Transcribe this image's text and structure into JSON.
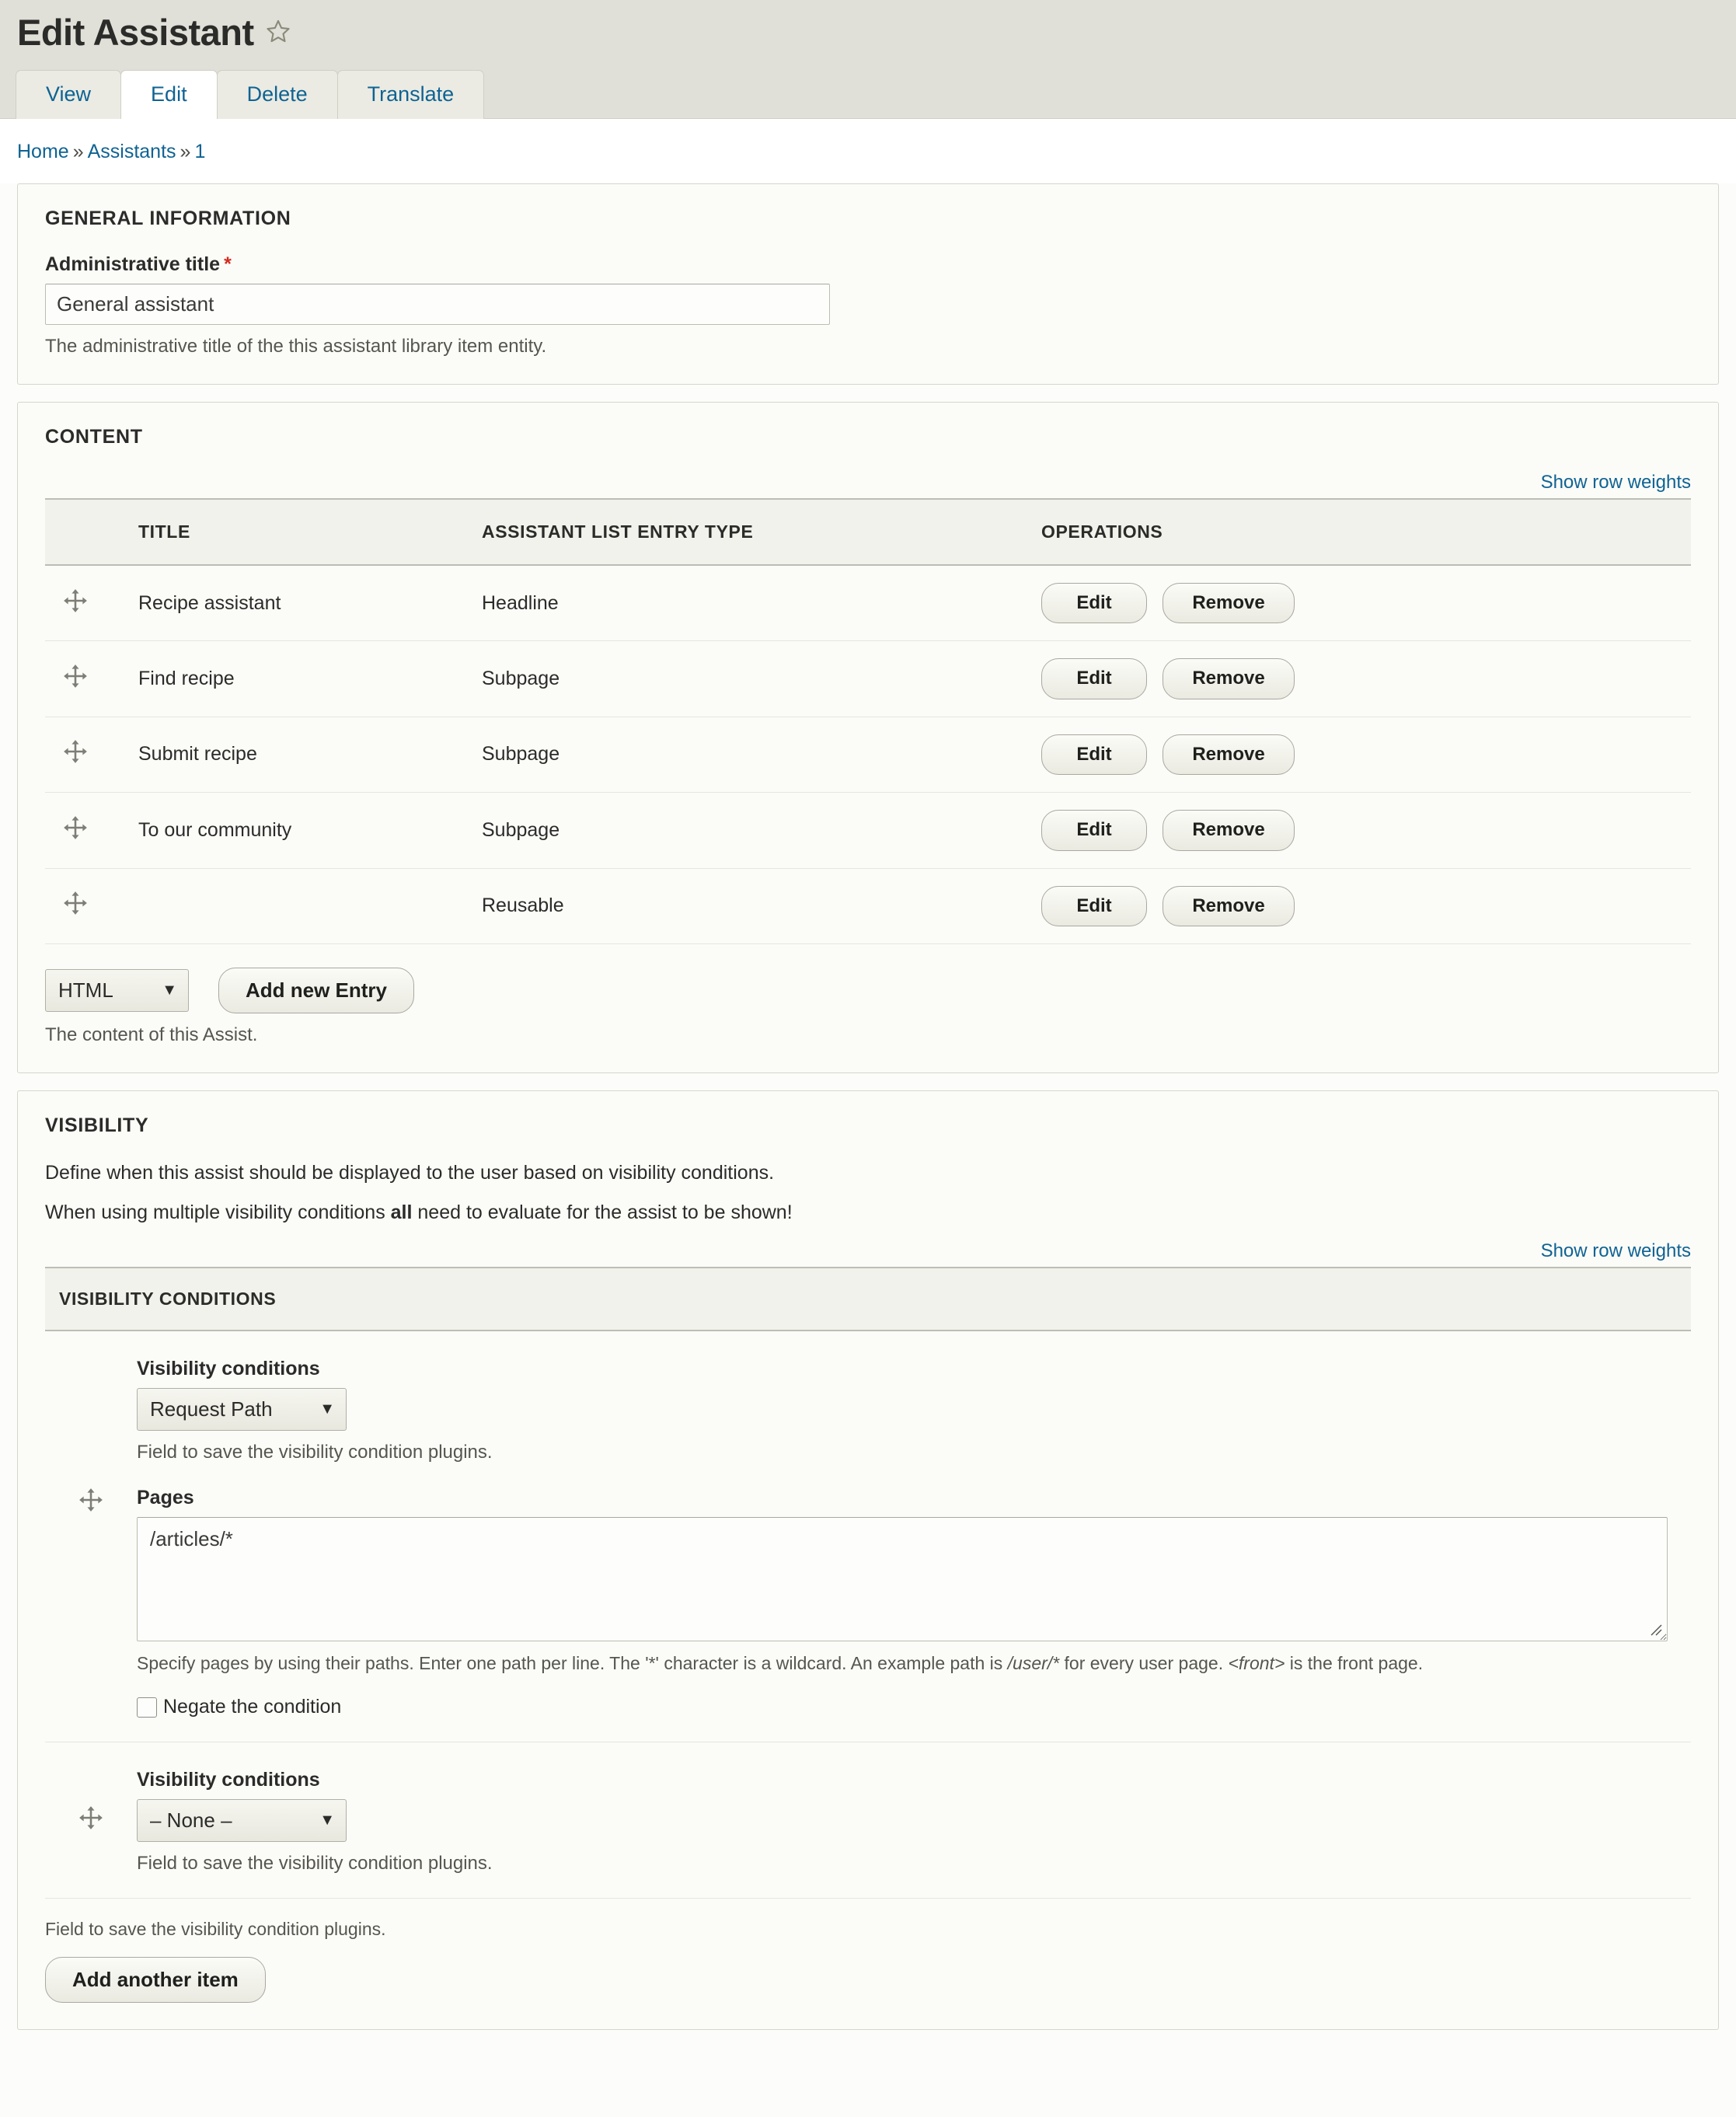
{
  "header": {
    "title": "Edit Assistant",
    "star_icon": "star-outline-icon",
    "tabs": [
      {
        "label": "View",
        "active": false
      },
      {
        "label": "Edit",
        "active": true
      },
      {
        "label": "Delete",
        "active": false
      },
      {
        "label": "Translate",
        "active": false
      }
    ]
  },
  "breadcrumb": {
    "items": [
      "Home",
      "Assistants",
      "1"
    ],
    "separator": "»"
  },
  "general_information": {
    "section_title": "General information",
    "field_label": "Administrative title",
    "required_marker": "*",
    "value": "General assistant",
    "description": "The administrative title of the this assistant library item entity."
  },
  "content": {
    "section_title": "Content",
    "show_row_weights": "Show row weights",
    "columns": [
      "",
      "Title",
      "Assistant list entry type",
      "Operations"
    ],
    "rows": [
      {
        "drag": "drag-handle-icon",
        "title": "Recipe assistant",
        "type": "Headline",
        "edit": "Edit",
        "remove": "Remove"
      },
      {
        "drag": "drag-handle-icon",
        "title": "Find recipe",
        "type": "Subpage",
        "edit": "Edit",
        "remove": "Remove"
      },
      {
        "drag": "drag-handle-icon",
        "title": "Submit recipe",
        "type": "Subpage",
        "edit": "Edit",
        "remove": "Remove"
      },
      {
        "drag": "drag-handle-icon",
        "title": "To our community",
        "type": "Subpage",
        "edit": "Edit",
        "remove": "Remove"
      },
      {
        "drag": "drag-handle-icon",
        "title": "",
        "type": "Reusable",
        "edit": "Edit",
        "remove": "Remove"
      }
    ],
    "entry_type_selected": "HTML",
    "entry_type_options": [
      "HTML"
    ],
    "add_new_entry": "Add new Entry",
    "description": "The content of this Assist."
  },
  "visibility": {
    "section_title": "Visibility",
    "intro_line1": "Define when this assist should be displayed to the user based on visibility conditions.",
    "intro_line2_pre": "When using multiple visibility conditions ",
    "intro_line2_bold": "all",
    "intro_line2_post": " need to evaluate for the assist to be shown!",
    "show_row_weights": "Show row weights",
    "fieldset_title": "Visibility conditions",
    "conditions": [
      {
        "select_label": "Visibility conditions",
        "select_value": "Request Path",
        "select_description": "Field to save the visibility condition plugins.",
        "pages_label": "Pages",
        "pages_value": "/articles/*",
        "pages_help_pre": "Specify pages by using their paths. Enter one path per line. The '*' character is a wildcard. An example path is ",
        "pages_help_em1": "/user/*",
        "pages_help_mid": " for every user page. ",
        "pages_help_em2": "<front>",
        "pages_help_post": " is the front page.",
        "negate_label": "Negate the condition",
        "negate_checked": false
      },
      {
        "select_label": "Visibility conditions",
        "select_value": "– None –",
        "select_description": "Field to save the visibility condition plugins."
      }
    ],
    "footer_description": "Field to save the visibility condition plugins.",
    "add_another_item": "Add another item"
  },
  "colors": {
    "header_bg": "#e0e0d8",
    "link": "#0f6393",
    "required": "#d42b1e",
    "panel_bg": "#fbfbf8",
    "table_head_bg": "#f2f2ec"
  }
}
